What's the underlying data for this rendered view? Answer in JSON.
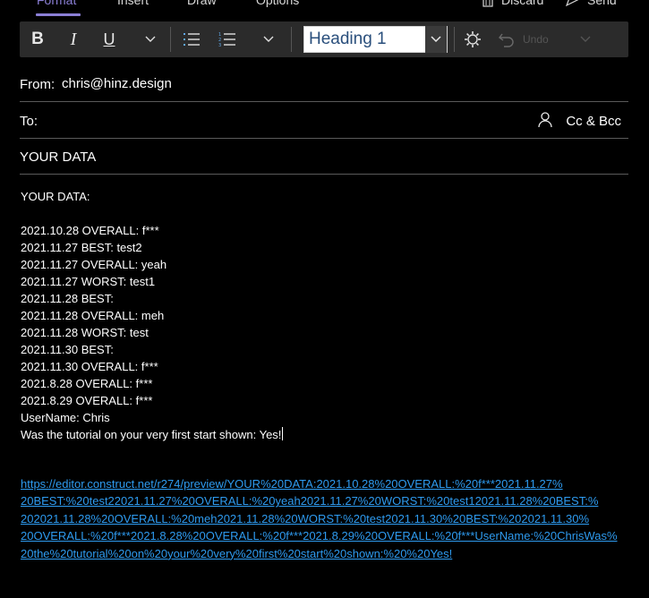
{
  "tabs": {
    "format": "Format",
    "insert": "Insert",
    "draw": "Draw",
    "options": "Options",
    "discard": "Discard",
    "send": "Send"
  },
  "toolbar": {
    "bold": "B",
    "italic": "I",
    "underline": "U",
    "style_value": "Heading 1",
    "undo": "Undo"
  },
  "from": {
    "label": "From:",
    "value": "chris@hinz.design"
  },
  "to": {
    "label": "To:",
    "cc_bcc": "Cc & Bcc"
  },
  "subject": "YOUR DATA",
  "body": {
    "lines": [
      "YOUR DATA:",
      "",
      "2021.10.28 OVERALL: f***",
      "2021.11.27 BEST: test2",
      "2021.11.27 OVERALL: yeah",
      "2021.11.27 WORST: test1",
      "2021.11.28 BEST:",
      "2021.11.28 OVERALL: meh",
      "2021.11.28 WORST: test",
      "2021.11.30 BEST:",
      "2021.11.30 OVERALL: f***",
      "2021.8.28 OVERALL: f***",
      "2021.8.29 OVERALL: f***",
      "UserName: Chris",
      "Was the tutorial on your very first start shown: Yes!"
    ],
    "link_lines": [
      "https://editor.construct.net/r274/preview/YOUR%20DATA:2021.10.28%20OVERALL:%20f***2021.11.27%",
      "20BEST:%20test22021.11.27%20OVERALL:%20yeah2021.11.27%20WORST:%20test12021.11.28%20BEST:%",
      "202021.11.28%20OVERALL:%20meh2021.11.28%20WORST:%20test2021.11.30%20BEST:%202021.11.30%",
      "20OVERALL:%20f***2021.8.28%20OVERALL:%20f***2021.8.29%20OVERALL:%20f***UserName:%20ChrisWas%",
      "20the%20tutorial%20on%20your%20very%20first%20start%20shown:%20%20Yes!"
    ]
  },
  "colors": {
    "accent": "#8b7fd6",
    "link": "#2e9bf0",
    "toolbar_bg": "#2b2b2b",
    "background": "#000000"
  },
  "icons": [
    "bullet-list-icon",
    "numbered-list-icon",
    "chevron-down-icon",
    "styles-gear-icon",
    "undo-icon",
    "discard-icon",
    "send-icon",
    "person-icon"
  ]
}
